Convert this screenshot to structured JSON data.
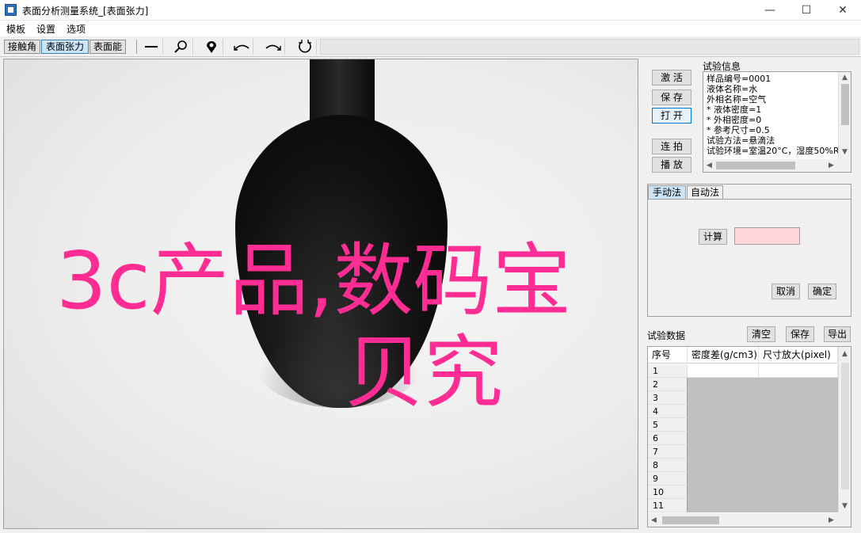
{
  "window": {
    "title": "表面分析测量系统_[表面张力]",
    "controls": {
      "minimize": "—",
      "maximize": "☐",
      "close": "✕"
    }
  },
  "menu": [
    "模板",
    "设置",
    "选项"
  ],
  "toolbar": {
    "modes": [
      "接触角",
      "表面张力",
      "表面能"
    ],
    "active_mode": "表面张力",
    "tools": [
      "line-tool-icon",
      "zoom-icon",
      "point-marker-icon",
      "left-arc-icon",
      "right-arc-icon",
      "circle-fit-icon"
    ]
  },
  "overlay_text": {
    "line1": "3c产品,数码宝",
    "line2": "贝究"
  },
  "side_buttons": {
    "activate": "激 活",
    "save": "保 存",
    "open": "打 开",
    "continuous": "连 拍",
    "play": "播 放"
  },
  "info": {
    "label": "试验信息",
    "lines": [
      "样品编号=0001",
      "液体名称=水",
      "外相名称=空气",
      "* 液体密度=1",
      "* 外相密度=0",
      "* 参考尺寸=0.5",
      "试验方法=悬滴法",
      "试验环境=室温20°C，湿度50%R"
    ]
  },
  "tabs": {
    "items": [
      "手动法",
      "自动法"
    ],
    "active": "手动法",
    "calc_button": "计算",
    "calc_value": "",
    "cancel_button": "取消",
    "confirm_button": "确定"
  },
  "data_section": {
    "label": "试验数据",
    "clear_button": "清空",
    "save_button": "保存",
    "export_button": "导出",
    "columns": [
      "序号",
      "密度差(g/cm3)",
      "尺寸放大(pixel)"
    ],
    "rows": [
      "1",
      "2",
      "3",
      "4",
      "5",
      "6",
      "7",
      "8",
      "9",
      "10",
      "11"
    ]
  }
}
